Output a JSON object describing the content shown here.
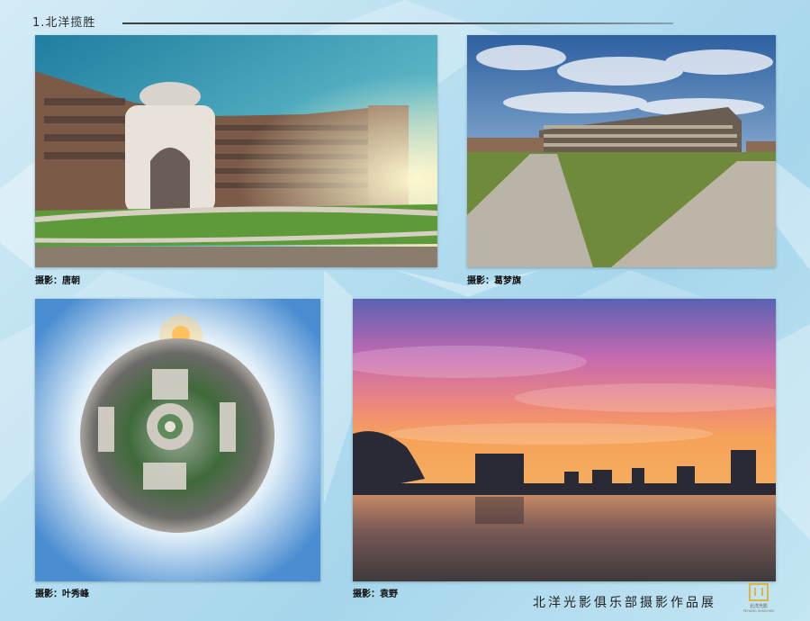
{
  "section": {
    "title": "1.北洋揽胜"
  },
  "photos": [
    {
      "subject": "domed-memorial-and-curved-building",
      "credit": "摄影：唐朝"
    },
    {
      "subject": "modern-building-with-walkways",
      "credit": "摄影：葛梦旗"
    },
    {
      "subject": "tiny-planet-campus-panorama",
      "credit": "摄影：叶秀峰"
    },
    {
      "subject": "sunset-over-lake",
      "credit": "摄影：袁野"
    }
  ],
  "footer": {
    "exhibition_title": "北洋光影俱乐部摄影作品展"
  },
  "logo": {
    "text": "北洋光影",
    "subtext": "PEIYANG SHADOWS"
  },
  "colors": {
    "accent_gold": "#e3b240",
    "background_blue": "#b6def0"
  }
}
